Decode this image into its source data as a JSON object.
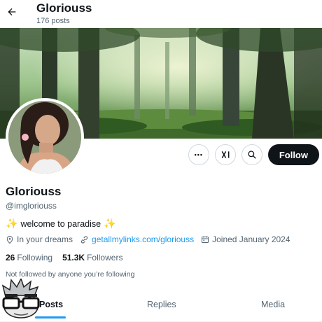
{
  "header": {
    "name": "Gloriouss",
    "posts_count": "176 posts"
  },
  "profile": {
    "display_name": "Gloriouss",
    "handle": "@imgloriouss",
    "bio_text": "welcome to paradise",
    "location": "In your dreams",
    "website": "getallmylinks.com/gloriouss",
    "joined": "Joined January 2024",
    "following_count": "26",
    "following_label": "Following",
    "followers_count": "51.3K",
    "followers_label": "Followers",
    "not_followed_text": "Not followed by anyone you’re following"
  },
  "actions": {
    "more_label": "•••",
    "follow_label": "Follow"
  },
  "tabs": [
    {
      "label": "Posts",
      "active": true
    },
    {
      "label": "Replies",
      "active": false
    },
    {
      "label": "Media",
      "active": false
    }
  ],
  "colors": {
    "accent": "#1d9bf0",
    "text": "#0f1419",
    "muted": "#536471",
    "follow_bg": "#0f1419"
  },
  "icons": [
    "back-arrow-icon",
    "more-icon",
    "grok-icon",
    "search-icon",
    "location-icon",
    "link-icon",
    "calendar-icon",
    "sparkle-icon"
  ]
}
